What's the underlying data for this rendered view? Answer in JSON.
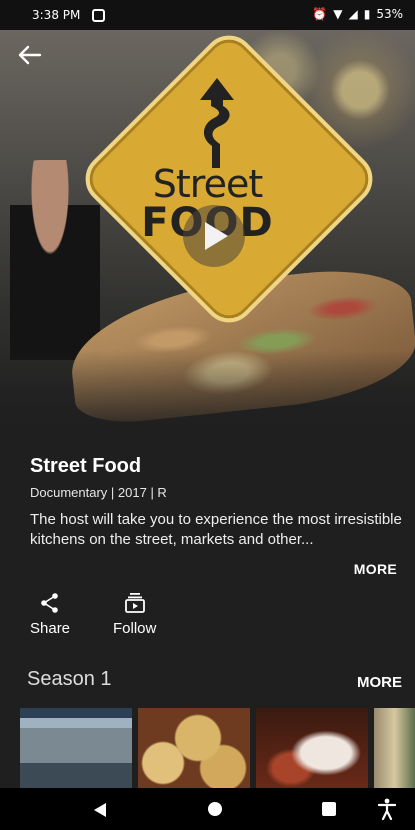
{
  "status_bar": {
    "time": "3:38 PM",
    "battery": "53%"
  },
  "hero": {
    "sign_line1": "Street",
    "sign_line2": "FOOD"
  },
  "show": {
    "title": "Street Food",
    "meta": "Documentary | 2017 | R",
    "description": "The host will take you to experience the most irresistible kitchens on the street, markets and other...",
    "more_label": "MORE"
  },
  "actions": {
    "share_label": "Share",
    "follow_label": "Follow"
  },
  "season": {
    "title": "Season 1",
    "more_label": "MORE"
  },
  "colors": {
    "background": "#1f1f1f",
    "sign": "#d9aa33"
  }
}
